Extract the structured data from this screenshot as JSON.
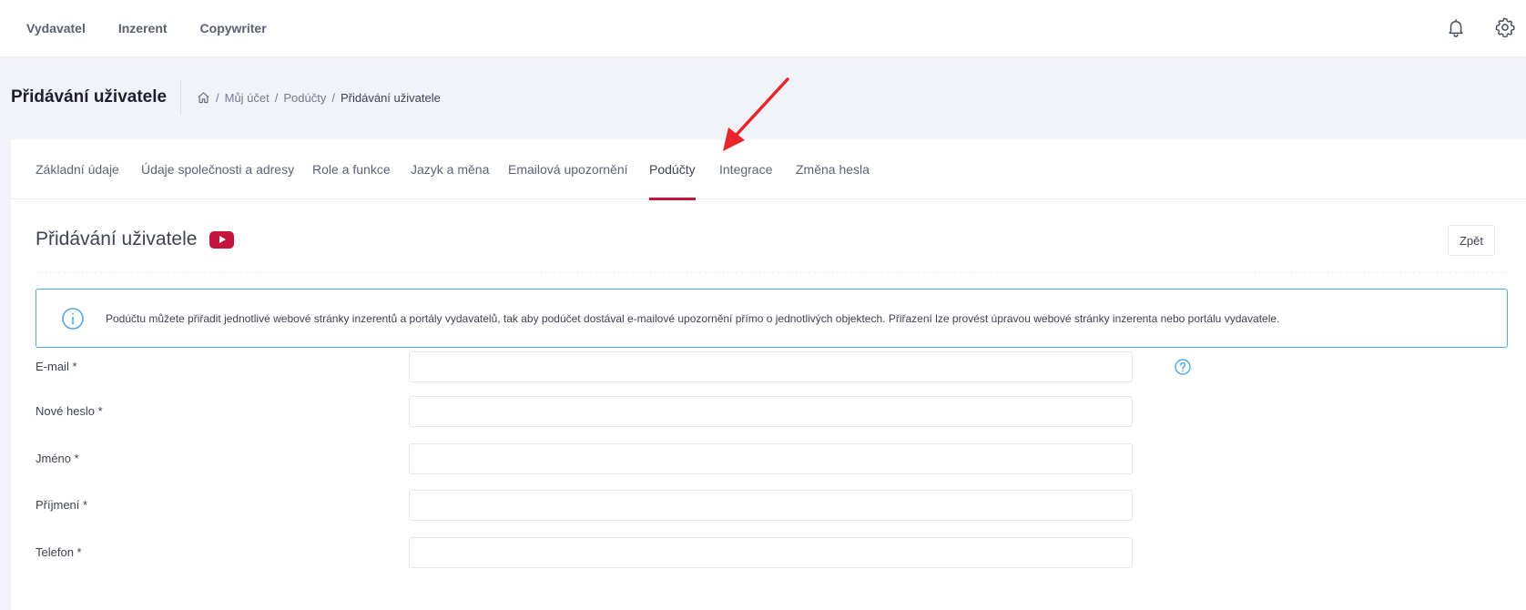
{
  "topnav": {
    "items": [
      "Vydavatel",
      "Inzerent",
      "Copywriter"
    ]
  },
  "icons": {
    "notifications": "bell-icon",
    "settings": "gear-icon",
    "home": "home-icon",
    "video": "youtube-icon",
    "info": "info-icon",
    "help": "question-icon"
  },
  "colors": {
    "accent": "#c4163d",
    "info_border": "#4fa8e4",
    "annotation_arrow": "#e8262b"
  },
  "header": {
    "title": "Přidávání uživatele",
    "breadcrumb": [
      "Můj účet",
      "Podúčty",
      "Přidávání uživatele"
    ]
  },
  "tabs": [
    {
      "label": "Základní údaje",
      "active": false
    },
    {
      "label": "Údaje společnosti a adresy",
      "active": false
    },
    {
      "label": "Role a funkce",
      "active": false
    },
    {
      "label": "Jazyk a měna",
      "active": false
    },
    {
      "label": "Emailová upozornění",
      "active": false
    },
    {
      "label": "Podúčty",
      "active": true
    },
    {
      "label": "Integrace",
      "active": false
    },
    {
      "label": "Změna hesla",
      "active": false
    }
  ],
  "content": {
    "title": "Přidávání uživatele",
    "back_label": "Zpět",
    "info_text": "Podúčtu můžete přiřadit jednotlivé webové stránky inzerentů a portály vydavatelů, tak aby podúčet dostával e-mailové upozornění přímo o jednotlivých objektech. Přiřazení lze provést úpravou webové stránky inzerenta nebo portálu vydavatele."
  },
  "form": {
    "fields": [
      {
        "label": "E-mail *",
        "value": ""
      },
      {
        "label": "Nové heslo *",
        "value": ""
      },
      {
        "label": "Jméno *",
        "value": ""
      },
      {
        "label": "Příjmení *",
        "value": ""
      },
      {
        "label": "Telefon *",
        "value": ""
      }
    ]
  }
}
